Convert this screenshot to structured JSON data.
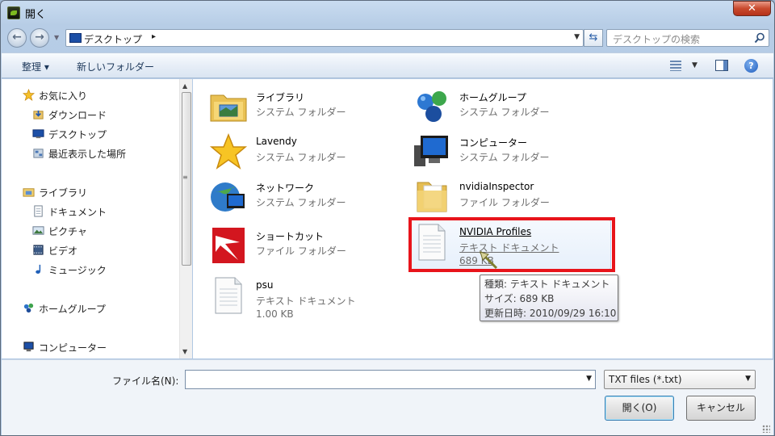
{
  "window": {
    "title": "開く",
    "close_label": "✕"
  },
  "address_bar": {
    "path": "デスクトップ",
    "separator": "▸"
  },
  "search": {
    "placeholder": "デスクトップの検索"
  },
  "toolbar": {
    "organize": "整理 ▾",
    "new_folder": "新しいフォルダー"
  },
  "nav_pane": {
    "favorites": {
      "label": "お気に入り",
      "items": [
        "ダウンロード",
        "デスクトップ",
        "最近表示した場所"
      ]
    },
    "libraries": {
      "label": "ライブラリ",
      "items": [
        "ドキュメント",
        "ピクチャ",
        "ビデオ",
        "ミュージック"
      ]
    },
    "homegroup": "ホームグループ",
    "computer": "コンピューター"
  },
  "items": [
    {
      "name": "ライブラリ",
      "type": "システム フォルダー",
      "icon": "library-folder-icon"
    },
    {
      "name": "ホームグループ",
      "type": "システム フォルダー",
      "icon": "homegroup-icon"
    },
    {
      "name": "Lavendy",
      "type": "システム フォルダー",
      "icon": "star-icon"
    },
    {
      "name": "コンピューター",
      "type": "システム フォルダー",
      "icon": "computer-icon"
    },
    {
      "name": "ネットワーク",
      "type": "システム フォルダー",
      "icon": "network-icon"
    },
    {
      "name": "nvidiaInspector",
      "type": "ファイル フォルダー",
      "icon": "folder-icon"
    },
    {
      "name": "ショートカット",
      "type": "ファイル フォルダー",
      "icon": "shortcut-app-icon"
    },
    {
      "name": "NVIDIA Profiles",
      "type": "テキスト ドキュメント",
      "size": "689 KB",
      "icon": "text-document-icon"
    },
    {
      "name": "psu",
      "type": "テキスト ドキュメント",
      "size": "1.00 KB",
      "icon": "text-document-icon"
    }
  ],
  "tooltip": {
    "type": "種類: テキスト ドキュメント",
    "size": "サイズ: 689 KB",
    "modified": "更新日時: 2010/09/29 16:10"
  },
  "footer": {
    "filename_label": "ファイル名(N):",
    "filename_value": "",
    "filetype": "TXT files (*.txt)",
    "open_button": "開く(O)",
    "cancel_button": "キャンセル"
  },
  "colors": {
    "highlight": "#e8141b",
    "hover": "#e7f0fb",
    "accent": "#1e5cbd"
  }
}
